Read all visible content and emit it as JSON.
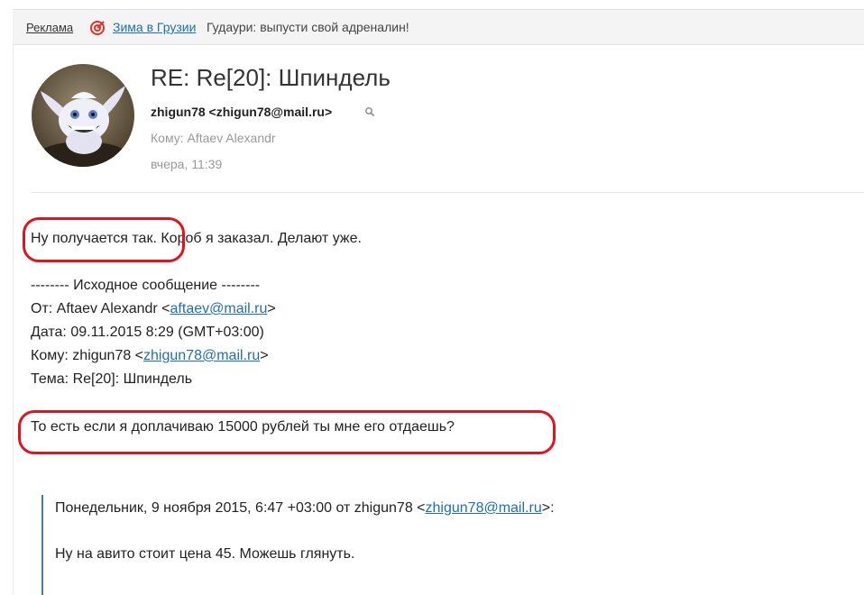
{
  "ad": {
    "label": "Реклама",
    "link_text": "Зима в Грузии",
    "text": "Гудаури: выпусти свой адреналин!"
  },
  "message": {
    "subject": "RE: Re[20]: Шпиндель",
    "from": "zhigun78 <zhigun78@mail.ru>",
    "to": "Кому: Aftaev Alexandr",
    "date": "вчера, 11:39"
  },
  "body": {
    "line1": "Ну получается так. Короб я заказал. Делают уже.",
    "original_header": "-------- Исходное сообщение --------",
    "from_prefix": "От: Aftaev Alexandr <",
    "from_email": "aftaev@mail.ru",
    "from_suffix": ">",
    "date_line": "Дата: 09.11.2015 8:29 (GMT+03:00)",
    "to_prefix": "Кому: zhigun78 <",
    "to_email": "zhigun78@mail.ru",
    "to_suffix": ">",
    "subject_line": "Тема: Re[20]: Шпиндель",
    "question": "То есть если я доплачиваю 15000 рублей ты мне его отдаешь?"
  },
  "quote": {
    "prefix": "Понедельник, 9 ноября 2015, 6:47 +03:00 от zhigun78 <",
    "email": "zhigun78@mail.ru",
    "suffix": ">:",
    "text": "Ну на авито стоит цена 45. Можешь глянуть."
  },
  "colors": {
    "link": "#1f6fb0",
    "annotation": "#e0141e",
    "quote_bar": "#3c7fb5"
  }
}
